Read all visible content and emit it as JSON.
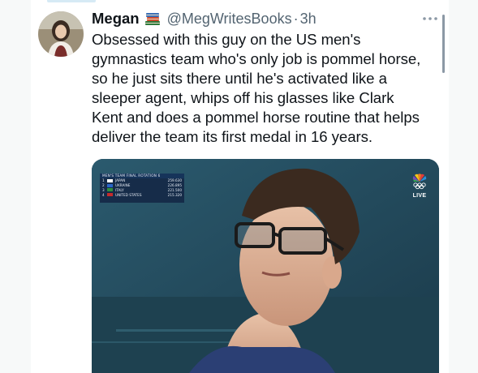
{
  "tweet": {
    "author_name": "Megan",
    "author_emoji_icon": "books-emoji-icon",
    "handle": "@MegWritesBooks",
    "separator": "·",
    "time": "3h",
    "text": "Obsessed with this guy on the US men's\ngymnastics team who's only job is pommel horse,\nso he just sits there until he's activated like a\nsleeper agent, whips off his glasses like Clark\nKent and does a pommel horse routine that helps\ndeliver the team its first medal in 16 years."
  },
  "media": {
    "scoreboard": {
      "title": "MEN'S TEAM FINAL  ROTATION 6",
      "rows": [
        {
          "rank": "1",
          "flag_color": "#ffffff",
          "country": "JAPAN",
          "score": "259.630"
        },
        {
          "rank": "2",
          "flag_color": "#2a66c9",
          "country": "UKRAINE",
          "score": "226.895"
        },
        {
          "rank": "3",
          "flag_color": "#2f8f3f",
          "country": "ITALY",
          "score": "221.500"
        },
        {
          "rank": "4",
          "flag_color": "#c62b2b",
          "country": "UNITED STATES",
          "score": "215.320"
        }
      ]
    },
    "network_logo_icon": "peacock-olympic-rings-icon",
    "live_label": "LIVE"
  },
  "colors": {
    "text_primary": "#0f1419",
    "text_secondary": "#536471",
    "video_background": "#244a5c"
  }
}
